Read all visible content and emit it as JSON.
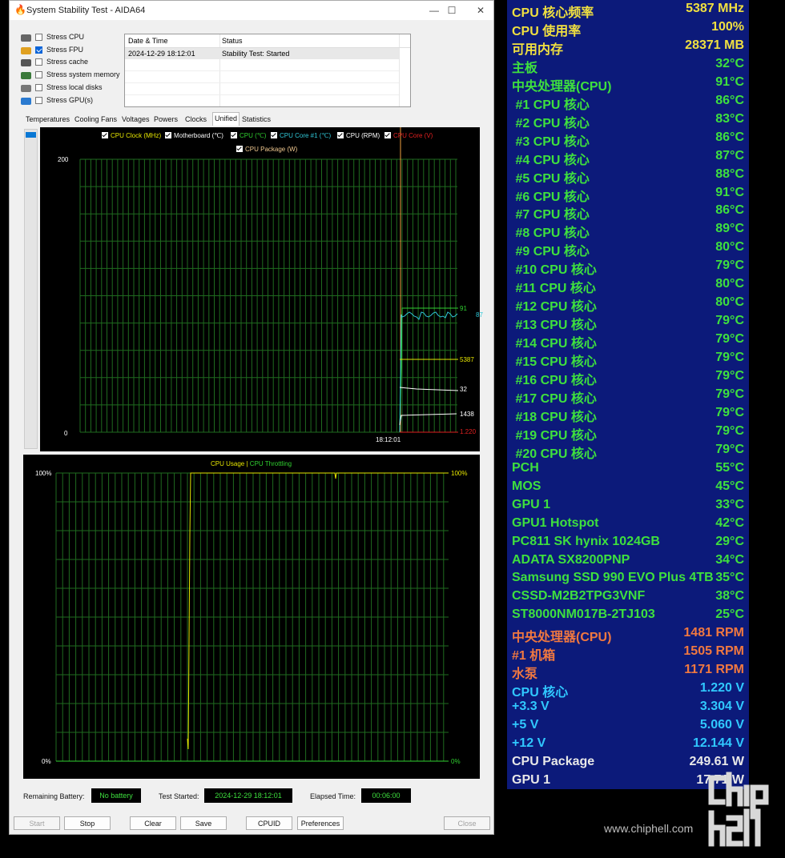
{
  "window": {
    "title": "System Stability Test - AIDA64",
    "controls": [
      "—",
      "☐",
      "✕"
    ]
  },
  "stress_options": [
    {
      "label": "Stress CPU",
      "checked": false,
      "icon": "cpu-chip-icon"
    },
    {
      "label": "Stress FPU",
      "checked": true,
      "icon": "fpu-123-icon"
    },
    {
      "label": "Stress cache",
      "checked": false,
      "icon": "cache-chip-icon"
    },
    {
      "label": "Stress system memory",
      "checked": false,
      "icon": "memory-module-icon"
    },
    {
      "label": "Stress local disks",
      "checked": false,
      "icon": "disk-drive-icon"
    },
    {
      "label": "Stress GPU(s)",
      "checked": false,
      "icon": "gpu-card-icon"
    }
  ],
  "log": {
    "headers": [
      "Date & Time",
      "Status"
    ],
    "rows": [
      [
        "2024-12-29 18:12:01",
        "Stability Test: Started"
      ]
    ]
  },
  "tabs": [
    "Temperatures",
    "Cooling Fans",
    "Voltages",
    "Powers",
    "Clocks",
    "Unified",
    "Statistics"
  ],
  "active_tab": "Unified",
  "unified_graph": {
    "legend": [
      {
        "label": "CPU Clock (MHz)",
        "color": "#e6e600"
      },
      {
        "label": "Motherboard (℃)",
        "color": "#ffffff"
      },
      {
        "label": "CPU (℃)",
        "color": "#30d030"
      },
      {
        "label": "CPU Core #1 (℃)",
        "color": "#30c8d8"
      },
      {
        "label": "CPU (RPM)",
        "color": "#ffffff"
      },
      {
        "label": "CPU Core (V)",
        "color": "#e02020"
      },
      {
        "label": "CPU Package (W)",
        "color": "#f0c890"
      }
    ],
    "y_max_label": "200",
    "y_min_label": "0",
    "time_label": "18:12:01",
    "end_values": [
      {
        "text": "91",
        "color": "#30d030"
      },
      {
        "text": "87",
        "color": "#30c8d8"
      },
      {
        "text": "5387",
        "color": "#e6e600"
      },
      {
        "text": "32",
        "color": "#ffffff"
      },
      {
        "text": "1438",
        "color": "#ffffff"
      },
      {
        "text": "1.220",
        "color": "#e02020"
      }
    ]
  },
  "usage_graph": {
    "legend_usage": "CPU Usage",
    "legend_sep": "|",
    "legend_throttling": "CPU Throttling",
    "y_top_left": "100%",
    "y_bottom_left": "0%",
    "y_top_right": "100%",
    "y_bottom_right": "0%",
    "usage_color": "#e6e600",
    "throttling_color": "#30d030"
  },
  "status_bar": {
    "remaining_battery_label": "Remaining Battery:",
    "remaining_battery": "No battery",
    "test_started_label": "Test Started:",
    "test_started": "2024-12-29 18:12:01",
    "elapsed_label": "Elapsed Time:",
    "elapsed": "00:06:00"
  },
  "buttons": {
    "start": "Start",
    "stop": "Stop",
    "clear": "Clear",
    "save": "Save",
    "cpuid": "CPUID",
    "preferences": "Preferences",
    "close": "Close"
  },
  "sensor_panel": [
    {
      "label": "CPU 核心频率",
      "value": "5387 MHz",
      "color": "#f0e040"
    },
    {
      "label": "CPU 使用率",
      "value": "100%",
      "color": "#f0e040"
    },
    {
      "label": "可用内存",
      "value": "28371 MB",
      "color": "#f0e040"
    },
    {
      "label": "主板",
      "value": "32°C",
      "color": "#3ee03e"
    },
    {
      "label": "中央处理器(CPU)",
      "value": "91°C",
      "color": "#3ee03e"
    },
    {
      "label": " #1 CPU 核心",
      "value": "86°C",
      "color": "#3ee03e"
    },
    {
      "label": " #2 CPU 核心",
      "value": "83°C",
      "color": "#3ee03e"
    },
    {
      "label": " #3 CPU 核心",
      "value": "86°C",
      "color": "#3ee03e"
    },
    {
      "label": " #4 CPU 核心",
      "value": "87°C",
      "color": "#3ee03e"
    },
    {
      "label": " #5 CPU 核心",
      "value": "88°C",
      "color": "#3ee03e"
    },
    {
      "label": " #6 CPU 核心",
      "value": "91°C",
      "color": "#3ee03e"
    },
    {
      "label": " #7 CPU 核心",
      "value": "86°C",
      "color": "#3ee03e"
    },
    {
      "label": " #8 CPU 核心",
      "value": "89°C",
      "color": "#3ee03e"
    },
    {
      "label": " #9 CPU 核心",
      "value": "80°C",
      "color": "#3ee03e"
    },
    {
      "label": " #10 CPU 核心",
      "value": "79°C",
      "color": "#3ee03e"
    },
    {
      "label": " #11 CPU 核心",
      "value": "80°C",
      "color": "#3ee03e"
    },
    {
      "label": " #12 CPU 核心",
      "value": "80°C",
      "color": "#3ee03e"
    },
    {
      "label": " #13 CPU 核心",
      "value": "79°C",
      "color": "#3ee03e"
    },
    {
      "label": " #14 CPU 核心",
      "value": "79°C",
      "color": "#3ee03e"
    },
    {
      "label": " #15 CPU 核心",
      "value": "79°C",
      "color": "#3ee03e"
    },
    {
      "label": " #16 CPU 核心",
      "value": "79°C",
      "color": "#3ee03e"
    },
    {
      "label": " #17 CPU 核心",
      "value": "79°C",
      "color": "#3ee03e"
    },
    {
      "label": " #18 CPU 核心",
      "value": "79°C",
      "color": "#3ee03e"
    },
    {
      "label": " #19 CPU 核心",
      "value": "79°C",
      "color": "#3ee03e"
    },
    {
      "label": " #20 CPU 核心",
      "value": "79°C",
      "color": "#3ee03e"
    },
    {
      "label": "PCH",
      "value": "55°C",
      "color": "#3ee03e"
    },
    {
      "label": "MOS",
      "value": "45°C",
      "color": "#3ee03e"
    },
    {
      "label": "GPU 1",
      "value": "33°C",
      "color": "#3ee03e"
    },
    {
      "label": "GPU1 Hotspot",
      "value": "42°C",
      "color": "#3ee03e"
    },
    {
      "label": "PC811 SK hynix 1024GB",
      "value": "29°C",
      "color": "#3ee03e"
    },
    {
      "label": "ADATA SX8200PNP",
      "value": "34°C",
      "color": "#3ee03e"
    },
    {
      "label": "Samsung SSD 990 EVO Plus 4TB",
      "value": "35°C",
      "color": "#3ee03e"
    },
    {
      "label": "CSSD-M2B2TPG3VNF",
      "value": "38°C",
      "color": "#3ee03e"
    },
    {
      "label": "ST8000NM017B-2TJ103",
      "value": "25°C",
      "color": "#3ee03e"
    },
    {
      "label": "中央处理器(CPU)",
      "value": "1481 RPM",
      "color": "#f07840"
    },
    {
      "label": "#1 机箱",
      "value": "1505 RPM",
      "color": "#f07840"
    },
    {
      "label": "水泵",
      "value": "1171 RPM",
      "color": "#f07840"
    },
    {
      "label": "CPU 核心",
      "value": "1.220 V",
      "color": "#30c8ff"
    },
    {
      "label": "+3.3 V",
      "value": "3.304 V",
      "color": "#30c8ff"
    },
    {
      "label": "+5 V",
      "value": "5.060 V",
      "color": "#30c8ff"
    },
    {
      "label": "+12 V",
      "value": "12.144 V",
      "color": "#30c8ff"
    },
    {
      "label": "CPU Package",
      "value": "249.61 W",
      "color": "#e8e8e8"
    },
    {
      "label": "GPU 1",
      "value": "17.71 W",
      "color": "#e8e8e8"
    }
  ],
  "watermark": {
    "url": "www.chiphell.com",
    "logo_text": "chip hell"
  }
}
